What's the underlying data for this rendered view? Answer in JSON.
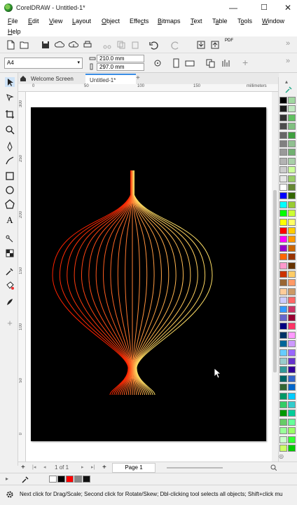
{
  "window": {
    "title": "CorelDRAW - Untitled-1*",
    "minimize": "—",
    "maximize": "☐",
    "close": "✕"
  },
  "menu": {
    "items": [
      {
        "pre": "",
        "u": "F",
        "post": "ile"
      },
      {
        "pre": "",
        "u": "E",
        "post": "dit"
      },
      {
        "pre": "",
        "u": "V",
        "post": "iew"
      },
      {
        "pre": "",
        "u": "L",
        "post": "ayout"
      },
      {
        "pre": "",
        "u": "O",
        "post": "bject"
      },
      {
        "pre": "Effe",
        "u": "c",
        "post": "ts"
      },
      {
        "pre": "",
        "u": "B",
        "post": "itmaps"
      },
      {
        "pre": "",
        "u": "T",
        "post": "ext"
      },
      {
        "pre": "T",
        "u": "a",
        "post": "ble"
      },
      {
        "pre": "T",
        "u": "o",
        "post": "ols"
      },
      {
        "pre": "",
        "u": "W",
        "post": "indow"
      },
      {
        "pre": "",
        "u": "H",
        "post": "elp"
      }
    ]
  },
  "toolbar": {
    "pdf_label": "PDF"
  },
  "propbar": {
    "page_size": "A4",
    "width": "210.0 mm",
    "height": "297.0 mm"
  },
  "tabs": {
    "welcome": "Welcome Screen",
    "document": "Untitled-1*",
    "add": "+"
  },
  "ruler": {
    "h_ticks": [
      "0",
      "50",
      "100",
      "150"
    ],
    "h_unit": "millimeters",
    "v_ticks": [
      "300",
      "250",
      "200",
      "150",
      "100",
      "50",
      "0"
    ],
    "v_unit": "millimeters"
  },
  "page_nav": {
    "add": "+",
    "current": "1",
    "of": "of",
    "total": "1",
    "page_tab": "Page 1"
  },
  "status": {
    "text": "Next click for Drag/Scale; Second click for Rotate/Skew; Dbl-clicking tool selects all objects; Shift+click mu"
  },
  "artwork": {
    "line_count": 23,
    "color_start": "#ff2200",
    "color_end": "#ffe066"
  },
  "palette": {
    "left_column": [
      "#000000",
      "#1a1a1a",
      "#333333",
      "#4d4d4d",
      "#666666",
      "#808080",
      "#999999",
      "#b3b3b3",
      "#cccccc",
      "#e6e6e6",
      "#ffffff",
      "#0000ff",
      "#00ffff",
      "#00ff00",
      "#ffff00",
      "#ff0000",
      "#ff00ff",
      "#9900cc",
      "#ff6600",
      "#ff99cc",
      "#cc3300",
      "#996633",
      "#ffcc99",
      "#ccccff",
      "#3399ff",
      "#6666cc",
      "#000080",
      "#003366",
      "#006699",
      "#66ccff",
      "#99cccc",
      "#339999",
      "#006666",
      "#336633",
      "#009966",
      "#33cc66",
      "#009900",
      "#66cc66",
      "#99ff99",
      "#ccffcc",
      "#ccff66"
    ],
    "right_column": [
      "#a0d8a0",
      "#c0e8c0",
      "#60c060",
      "#80c080",
      "#40a040",
      "#90c090",
      "#70b070",
      "#a8d0a8",
      "#ccff99",
      "#99cc66",
      "#668833",
      "#336600",
      "#99cc33",
      "#ccff33",
      "#ffff66",
      "#ffcc00",
      "#ff9900",
      "#cc6600",
      "#993300",
      "#663300",
      "#ffcc66",
      "#ff9966",
      "#cc9966",
      "#ff6666",
      "#cc3366",
      "#990033",
      "#ff3366",
      "#ff99ff",
      "#cc99ff",
      "#9966ff",
      "#6633cc",
      "#330099",
      "#3366cc",
      "#0066cc",
      "#00ccff",
      "#33cccc",
      "#00cc99",
      "#66ff99",
      "#99ff66",
      "#33ff33",
      "#00cc00"
    ],
    "bottom_swatches": [
      "#ffffff",
      "#000000",
      "#ff0000",
      "#888888",
      "#111111"
    ]
  }
}
